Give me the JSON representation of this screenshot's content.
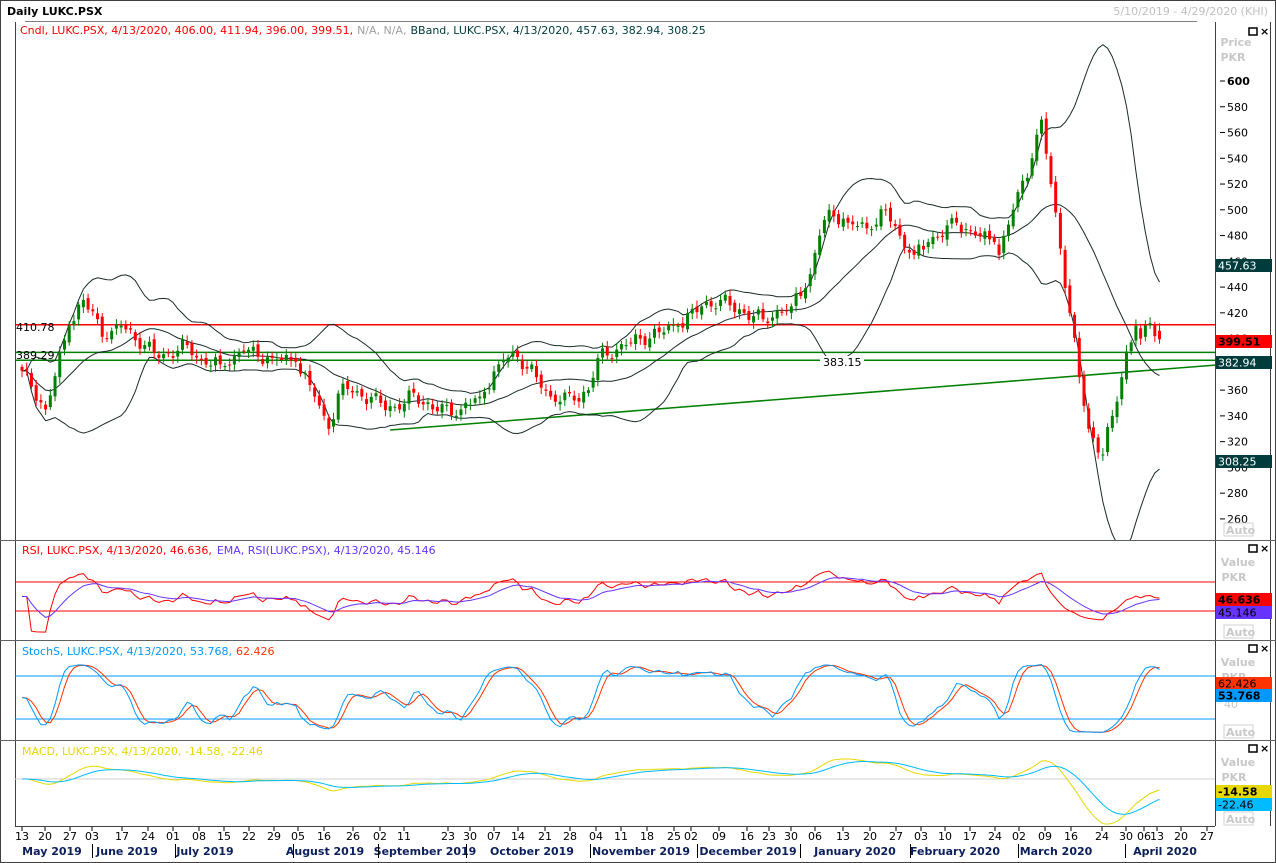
{
  "window": {
    "title": "Daily LUKC.PSX",
    "range": "5/10/2019 - 4/29/2020 (KHI)",
    "maximize_icon": "window-maximize-icon",
    "close_icon": "close-icon",
    "auto_label": "Auto"
  },
  "legend": {
    "candle": [
      "Cndl, LUKC.PSX, 4/13/2020, 406.00, 411.94, 396.00, 399.51,",
      "N/A, N/A,"
    ],
    "bband": "BBand, LUKC.PSX, 4/13/2020, 457.63, 382.94, 308.25",
    "rsi": "RSI, LUKC.PSX, 4/13/2020, 46.636,",
    "ema": "EMA, RSI(LUKC.PSX), 4/13/2020, 45.146",
    "stoch": "StochS, LUKC.PSX, 4/13/2020, 53.768,",
    "stoch_d": "62.426",
    "macd": "MACD, LUKC.PSX, 4/13/2020, -14.58, -22.46"
  },
  "axes": {
    "price_title": "Price",
    "value_title": "Value",
    "unit": "PKR",
    "price_ticks": [
      600,
      580,
      560,
      540,
      520,
      500,
      480,
      460,
      440,
      420,
      400,
      380,
      360,
      340,
      320,
      300,
      280,
      260
    ],
    "stoch_tick": "40",
    "day_ticks": [
      "13",
      "20",
      "27",
      "03",
      "17",
      "24",
      "01",
      "08",
      "15",
      "22",
      "29",
      "05",
      "16",
      "26",
      "02",
      "11",
      "23",
      "30",
      "07",
      "14",
      "21",
      "28",
      "04",
      "11",
      "18",
      "25",
      "02",
      "09",
      "16",
      "23",
      "30",
      "06",
      "13",
      "20",
      "27",
      "03",
      "10",
      "17",
      "24",
      "02",
      "09",
      "16",
      "24",
      "30",
      "06",
      "13",
      "20",
      "27"
    ],
    "months": [
      "May 2019",
      "June 2019",
      "July 2019",
      "August 2019",
      "September 2019",
      "October 2019",
      "November 2019",
      "December 2019",
      "January 2020",
      "February 2020",
      "March 2020",
      "April 2020"
    ]
  },
  "badges": {
    "bb_upper": "457.63",
    "close": "399.51",
    "bb_mid": "382.94",
    "bb_lower": "308.25",
    "rsi": "46.636",
    "rsi_ema": "45.146",
    "stoch_d": "62.426",
    "stoch_k": "53.768",
    "macd": "-14.58",
    "macd_signal": "-22.46"
  },
  "colors": {
    "up": "#008000",
    "down": "#ff0000",
    "band": "#1a2a2a",
    "rsi": "#ff0000",
    "rsi_ema": "#6633ff",
    "stoch_k": "#0099ff",
    "stoch_d": "#ff3300",
    "macd": "#e6d800",
    "macd_signal": "#00bbff",
    "badge_band": "#003c3c"
  },
  "chart_data": {
    "type": "candlestick",
    "title": "Daily LUKC.PSX",
    "ylabel": "Price PKR",
    "ylim": [
      250,
      628
    ],
    "close_keypoints": [
      [
        0,
        375
      ],
      [
        5,
        345
      ],
      [
        10,
        410
      ],
      [
        13,
        430
      ],
      [
        18,
        400
      ],
      [
        21,
        410
      ],
      [
        26,
        395
      ],
      [
        29,
        385
      ],
      [
        35,
        395
      ],
      [
        38,
        383
      ],
      [
        42,
        380
      ],
      [
        47,
        390
      ],
      [
        53,
        385
      ],
      [
        58,
        382
      ],
      [
        62,
        355
      ],
      [
        65,
        330
      ],
      [
        68,
        365
      ],
      [
        72,
        355
      ],
      [
        76,
        350
      ],
      [
        80,
        345
      ],
      [
        83,
        358
      ],
      [
        87,
        345
      ],
      [
        93,
        345
      ],
      [
        97,
        355
      ],
      [
        101,
        380
      ],
      [
        104,
        390
      ],
      [
        109,
        370
      ],
      [
        112,
        355
      ],
      [
        117,
        352
      ],
      [
        120,
        360
      ],
      [
        122,
        385
      ],
      [
        128,
        395
      ],
      [
        131,
        400
      ],
      [
        135,
        405
      ],
      [
        139,
        410
      ],
      [
        144,
        425
      ],
      [
        148,
        430
      ],
      [
        153,
        420
      ],
      [
        157,
        415
      ],
      [
        163,
        425
      ],
      [
        167,
        450
      ],
      [
        169,
        480
      ],
      [
        171,
        500
      ],
      [
        175,
        490
      ],
      [
        180,
        485
      ],
      [
        183,
        500
      ],
      [
        186,
        480
      ],
      [
        189,
        465
      ],
      [
        192,
        475
      ],
      [
        198,
        490
      ],
      [
        202,
        480
      ],
      [
        206,
        475
      ],
      [
        207,
        465
      ],
      [
        210,
        500
      ],
      [
        214,
        540
      ],
      [
        216,
        570
      ],
      [
        218,
        520
      ],
      [
        220,
        470
      ],
      [
        222,
        420
      ],
      [
        224,
        370
      ],
      [
        226,
        330
      ],
      [
        229,
        310
      ],
      [
        231,
        340
      ],
      [
        233,
        370
      ],
      [
        234,
        390
      ],
      [
        236,
        410
      ],
      [
        237,
        400
      ],
      [
        239,
        412
      ],
      [
        241,
        399.51
      ]
    ],
    "last_bar": {
      "date": "4/13/2020",
      "open": 406.0,
      "high": 411.94,
      "low": 396.0,
      "close": 399.51
    },
    "bollinger_last": {
      "upper": 457.63,
      "mid": 382.94,
      "lower": 308.25
    },
    "horizontal_lines": [
      {
        "value": 410.78,
        "label": "410.78",
        "color": "#ff0000"
      },
      {
        "value": 389.29,
        "label": "389.29",
        "color": "#008000"
      },
      {
        "value": 383.15,
        "label": "383.15",
        "color": "#008000"
      }
    ],
    "trendline": {
      "from": [
        78,
        329
      ],
      "to": [
        253,
        379.5
      ],
      "color": "#008000"
    },
    "indicators": {
      "rsi": {
        "last": 46.636,
        "ema_last": 45.146,
        "levels": [
          70,
          30
        ]
      },
      "stoch": {
        "k_last": 53.768,
        "d_last": 62.426,
        "levels": [
          80,
          20
        ]
      },
      "macd": {
        "macd_last": -14.58,
        "signal_last": -22.46
      }
    }
  }
}
